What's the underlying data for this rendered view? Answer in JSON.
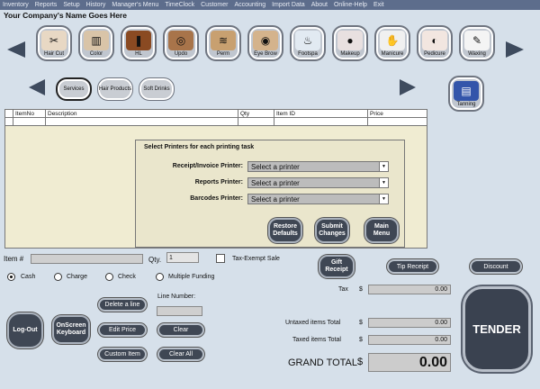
{
  "menu": [
    "Inventory",
    "Reports",
    "Setup",
    "History",
    "Manager's Menu",
    "TimeClock",
    "Customer",
    "Accounting",
    "Import Data",
    "About",
    "Online-Help",
    "Exit"
  ],
  "company_name": "Your Company's Name Goes Here",
  "services": [
    {
      "label": "Hair Cut",
      "icon": "✂",
      "icon_name": "haircut-icon"
    },
    {
      "label": "Color",
      "icon": "▥",
      "icon_name": "color-icon"
    },
    {
      "label": "HL",
      "icon": "❚",
      "icon_name": "highlight-icon"
    },
    {
      "label": "Updo",
      "icon": "◎",
      "icon_name": "updo-icon"
    },
    {
      "label": "Perm",
      "icon": "≋",
      "icon_name": "perm-icon"
    },
    {
      "label": "Eye Brow",
      "icon": "◉",
      "icon_name": "eyebrow-icon"
    },
    {
      "label": "Footspa",
      "icon": "♨",
      "icon_name": "footspa-icon"
    },
    {
      "label": "Makeup",
      "icon": "●",
      "icon_name": "makeup-icon"
    },
    {
      "label": "Manicure",
      "icon": "✋",
      "icon_name": "manicure-icon"
    },
    {
      "label": "Pedicure",
      "icon": "◐",
      "icon_name": "pedicure-icon"
    },
    {
      "label": "Waxing",
      "icon": "✎",
      "icon_name": "waxing-icon"
    }
  ],
  "categories": [
    "Services",
    "Hair Products",
    "Soft Drinks"
  ],
  "tanning_label": "Tanning",
  "table": {
    "headers": [
      "ItemNo",
      "Description",
      "Qty",
      "Item ID",
      "Price"
    ]
  },
  "printers": {
    "title": "Select Printers for each printing task",
    "rows": [
      {
        "label": "Receipt/Invoice Printer:",
        "value": "Select a printer"
      },
      {
        "label": "Reports Printer:",
        "value": "Select a printer"
      },
      {
        "label": "Barcodes Printer:",
        "value": "Select a printer"
      }
    ],
    "restore": "Restore Defaults",
    "submit": "Submit Changes",
    "main_menu": "Main Menu"
  },
  "item_label": "Item #",
  "qty_label": "Qty.",
  "qty_value": "1",
  "tax_exempt": "Tax-Exempt Sale",
  "gift_receipt": "Gift Receipt",
  "tip_receipt": "Tip Receipt",
  "discount": "Discount",
  "payment": {
    "cash": "Cash",
    "charge": "Charge",
    "check": "Check",
    "multiple": "Multiple Funding"
  },
  "line_number_label": "Line Number:",
  "buttons": {
    "logout": "Log-Out",
    "keyboard": "OnScreen Keyboard",
    "delete_line": "Delete a line",
    "edit_price": "Edit Price",
    "clear": "Clear",
    "custom_item": "Custom Item",
    "clear_all": "Clear All"
  },
  "totals": {
    "tax_label": "Tax",
    "tax_value": "0.00",
    "untaxed_label": "Untaxed items Total",
    "untaxed_value": "0.00",
    "taxed_label": "Taxed items Total",
    "taxed_value": "0.00",
    "grand_label": "GRAND TOTAL",
    "grand_value": "0.00",
    "currency": "$"
  },
  "tender": "TENDER"
}
